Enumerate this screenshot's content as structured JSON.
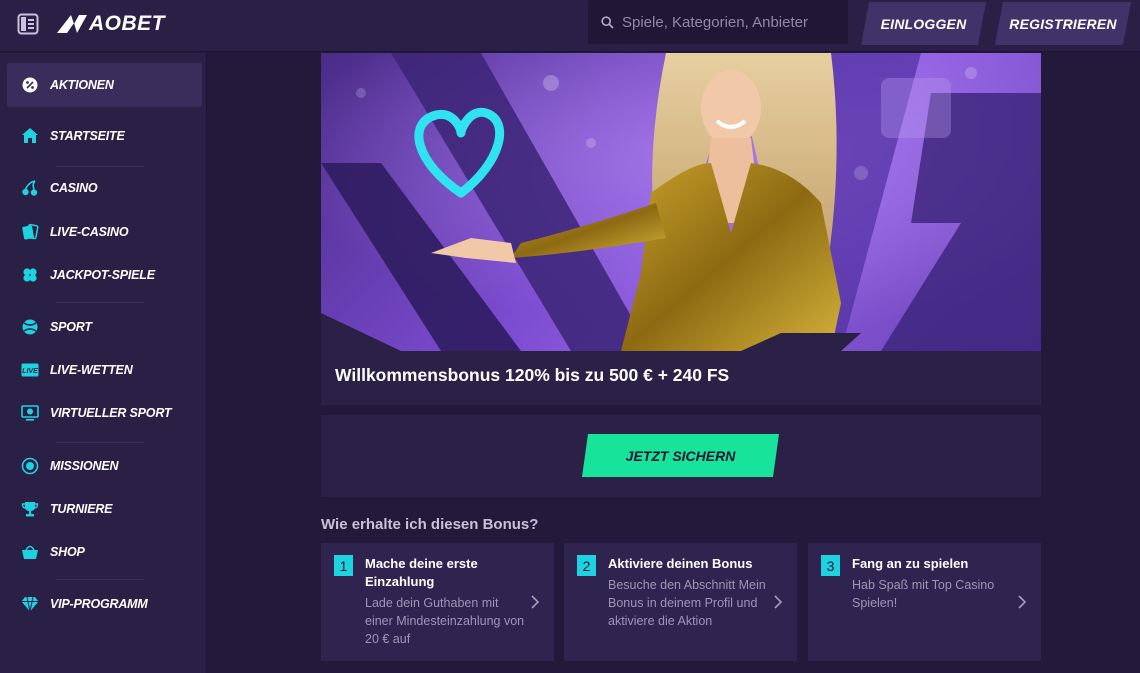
{
  "brand": {
    "name": "AOBET",
    "accent_color": "#17e39a",
    "icon_color": "#1ed3e0"
  },
  "header": {
    "search_placeholder": "Spiele, Kategorien, Anbieter",
    "login_label": "EINLOGGEN",
    "register_label": "REGISTRIEREN"
  },
  "sidebar": {
    "items": [
      {
        "label": "AKTIONEN",
        "icon": "promo-icon",
        "active": true
      },
      {
        "label": "STARTSEITE",
        "icon": "home-icon"
      },
      {
        "label": "CASINO",
        "icon": "cherry-icon"
      },
      {
        "label": "LIVE-CASINO",
        "icon": "cards-icon"
      },
      {
        "label": "JACKPOT-SPIELE",
        "icon": "clover-icon"
      },
      {
        "label": "SPORT",
        "icon": "ball-icon"
      },
      {
        "label": "LIVE-WETTEN",
        "icon": "live-icon"
      },
      {
        "label": "VIRTUELLER SPORT",
        "icon": "monitor-icon"
      },
      {
        "label": "MISSIONEN",
        "icon": "medal-icon"
      },
      {
        "label": "TURNIERE",
        "icon": "trophy-icon"
      },
      {
        "label": "SHOP",
        "icon": "basket-icon"
      },
      {
        "label": "VIP-PROGRAMM",
        "icon": "diamond-icon"
      }
    ]
  },
  "promo": {
    "title": "Willkommensbonus 120% bis zu 500 € + 240 FS",
    "cta_label": "JETZT SICHERN"
  },
  "how_to": {
    "title": "Wie erhalte ich diesen Bonus?",
    "steps": [
      {
        "number": "1",
        "title": "Mache deine erste Einzahlung",
        "description": "Lade dein Guthaben mit einer Mindesteinzahlung von 20 € auf"
      },
      {
        "number": "2",
        "title": "Aktiviere deinen Bonus",
        "description": "Besuche den Abschnitt Mein Bonus in deinem Profil und aktiviere die Aktion"
      },
      {
        "number": "3",
        "title": "Fang an zu spielen",
        "description": "Hab Spaß mit Top Casino Spielen!"
      }
    ]
  }
}
